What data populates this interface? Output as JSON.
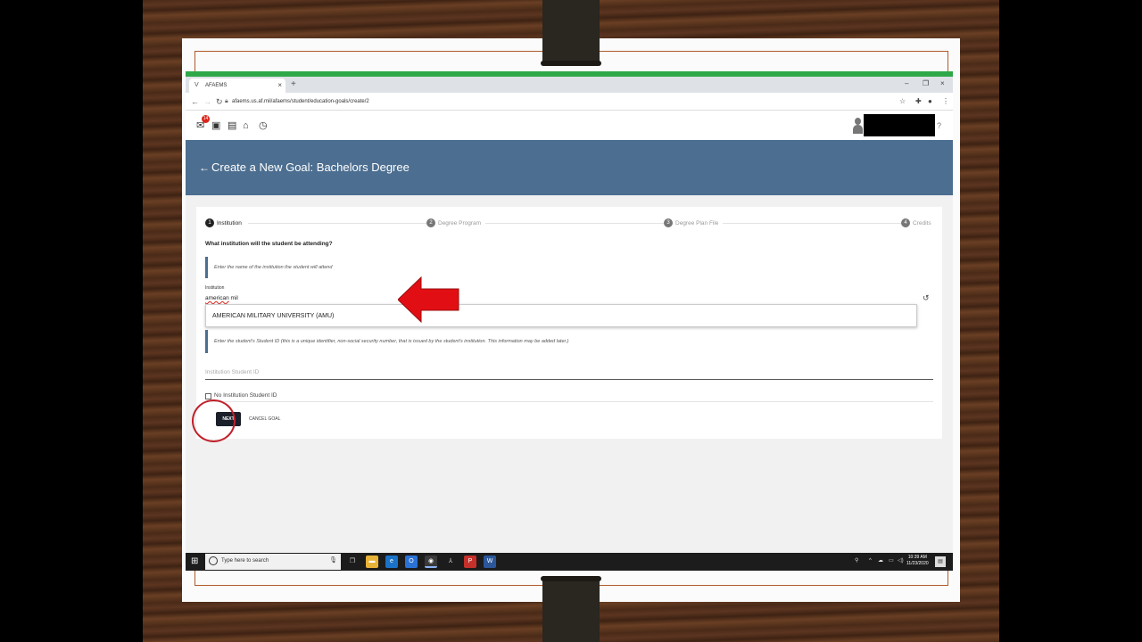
{
  "browser": {
    "tab_title": "AFAEMS",
    "url": "afaems.us.af.mil/afaems/student/education-goals/create/2"
  },
  "toolbar": {
    "notification_count": "14",
    "icons": [
      "mail-icon",
      "contact-card-icon",
      "clipboard-icon",
      "institution-icon",
      "clock-icon"
    ]
  },
  "page": {
    "title": "Create a New Goal: Bachelors Degree"
  },
  "steps": [
    {
      "num": "1",
      "label": "Institution",
      "active": true
    },
    {
      "num": "2",
      "label": "Degree Program",
      "active": false
    },
    {
      "num": "3",
      "label": "Degree Plan File",
      "active": false
    },
    {
      "num": "4",
      "label": "Credits",
      "active": false
    }
  ],
  "form": {
    "question": "What institution will the student be attending?",
    "institution_hint": "Enter the name of the institution the student will attend",
    "institution_label": "Institution",
    "institution_value_part1": "american",
    "institution_value_part2": " mil",
    "dropdown_option": "AMERICAN MILITARY UNIVERSITY (AMU)",
    "student_id_hint": "Enter the student's Student ID (this is a unique identifier, non-social security number, that is issued by the student's institution. This information may be added later.)",
    "student_id_placeholder": "Institution Student ID",
    "no_student_id_label": "No Institution Student ID",
    "next_label": "NEXT",
    "cancel_label": "CANCEL GOAL"
  },
  "taskbar": {
    "search_placeholder": "Type here to search",
    "time": "10:39 AM",
    "date": "11/23/2020"
  },
  "colors": {
    "header_bg": "#4c6e90",
    "annotation_red": "#d9261c",
    "next_button": "#1a1f2a"
  }
}
